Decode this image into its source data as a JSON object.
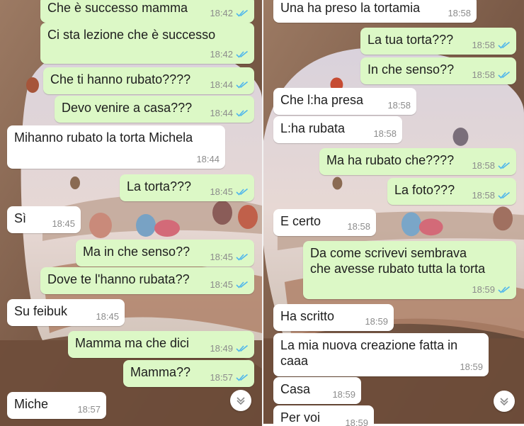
{
  "left_panel": {
    "messages": [
      {
        "side": "out",
        "text": "Che è successo mamma",
        "time": "18:42",
        "ticks": true
      },
      {
        "side": "out",
        "text": "Ci sta lezione che è successo",
        "time": "18:42",
        "ticks": true
      },
      {
        "side": "out",
        "text": "Che ti hanno rubato????",
        "time": "18:44",
        "ticks": true
      },
      {
        "side": "out",
        "text": "Devo venire a casa???",
        "time": "18:44",
        "ticks": true
      },
      {
        "side": "in",
        "text": "Mihanno rubato la torta Michela",
        "time": "18:44",
        "ticks": false
      },
      {
        "side": "out",
        "text": "La torta???",
        "time": "18:45",
        "ticks": true
      },
      {
        "side": "in",
        "text": "Sì",
        "time": "18:45",
        "ticks": false
      },
      {
        "side": "out",
        "text": "Ma in che senso??",
        "time": "18:45",
        "ticks": true
      },
      {
        "side": "out",
        "text": "Dove te l'hanno rubata??",
        "time": "18:45",
        "ticks": true
      },
      {
        "side": "in",
        "text": "Su feibuk",
        "time": "18:45",
        "ticks": false
      },
      {
        "side": "out",
        "text": "Mamma ma che dici",
        "time": "18:49",
        "ticks": true
      },
      {
        "side": "out",
        "text": "Mamma??",
        "time": "18:57",
        "ticks": true
      },
      {
        "side": "in",
        "text": "Miche",
        "time": "18:57",
        "ticks": false
      }
    ]
  },
  "right_panel": {
    "messages": [
      {
        "side": "in",
        "text": "Una ha preso la tortamia",
        "time": "18:58",
        "ticks": false
      },
      {
        "side": "out",
        "text": "La tua torta???",
        "time": "18:58",
        "ticks": true
      },
      {
        "side": "out",
        "text": "In che senso??",
        "time": "18:58",
        "ticks": true
      },
      {
        "side": "in",
        "text": "Che l:ha presa",
        "time": "18:58",
        "ticks": false
      },
      {
        "side": "in",
        "text": "L:ha rubata",
        "time": "18:58",
        "ticks": false
      },
      {
        "side": "out",
        "text": "Ma ha rubato che????",
        "time": "18:58",
        "ticks": true
      },
      {
        "side": "out",
        "text": "La foto???",
        "time": "18:58",
        "ticks": true
      },
      {
        "side": "in",
        "text": "E certo",
        "time": "18:58",
        "ticks": false
      },
      {
        "side": "out",
        "text": "Da come scrivevi sembrava\nche avesse rubato tutta la torta",
        "time": "18:59",
        "ticks": true
      },
      {
        "side": "in",
        "text": "Ha scritto",
        "time": "18:59",
        "ticks": false
      },
      {
        "side": "in",
        "text": "La mia nuova creazione fatta in\ncaaa",
        "time": "18:59",
        "ticks": false
      },
      {
        "side": "in",
        "text": "Casa",
        "time": "18:59",
        "ticks": false
      },
      {
        "side": "in",
        "text": "Per voi",
        "time": "18:59",
        "ticks": false
      }
    ]
  },
  "icons": {
    "read_receipt": "double-check-icon",
    "scroll": "chevron-down-icon"
  },
  "colors": {
    "outgoing_bubble": "#dcf8c6",
    "incoming_bubble": "#ffffff",
    "tick_blue": "#4fb6ec",
    "time_gray": "#8c8c8c"
  }
}
